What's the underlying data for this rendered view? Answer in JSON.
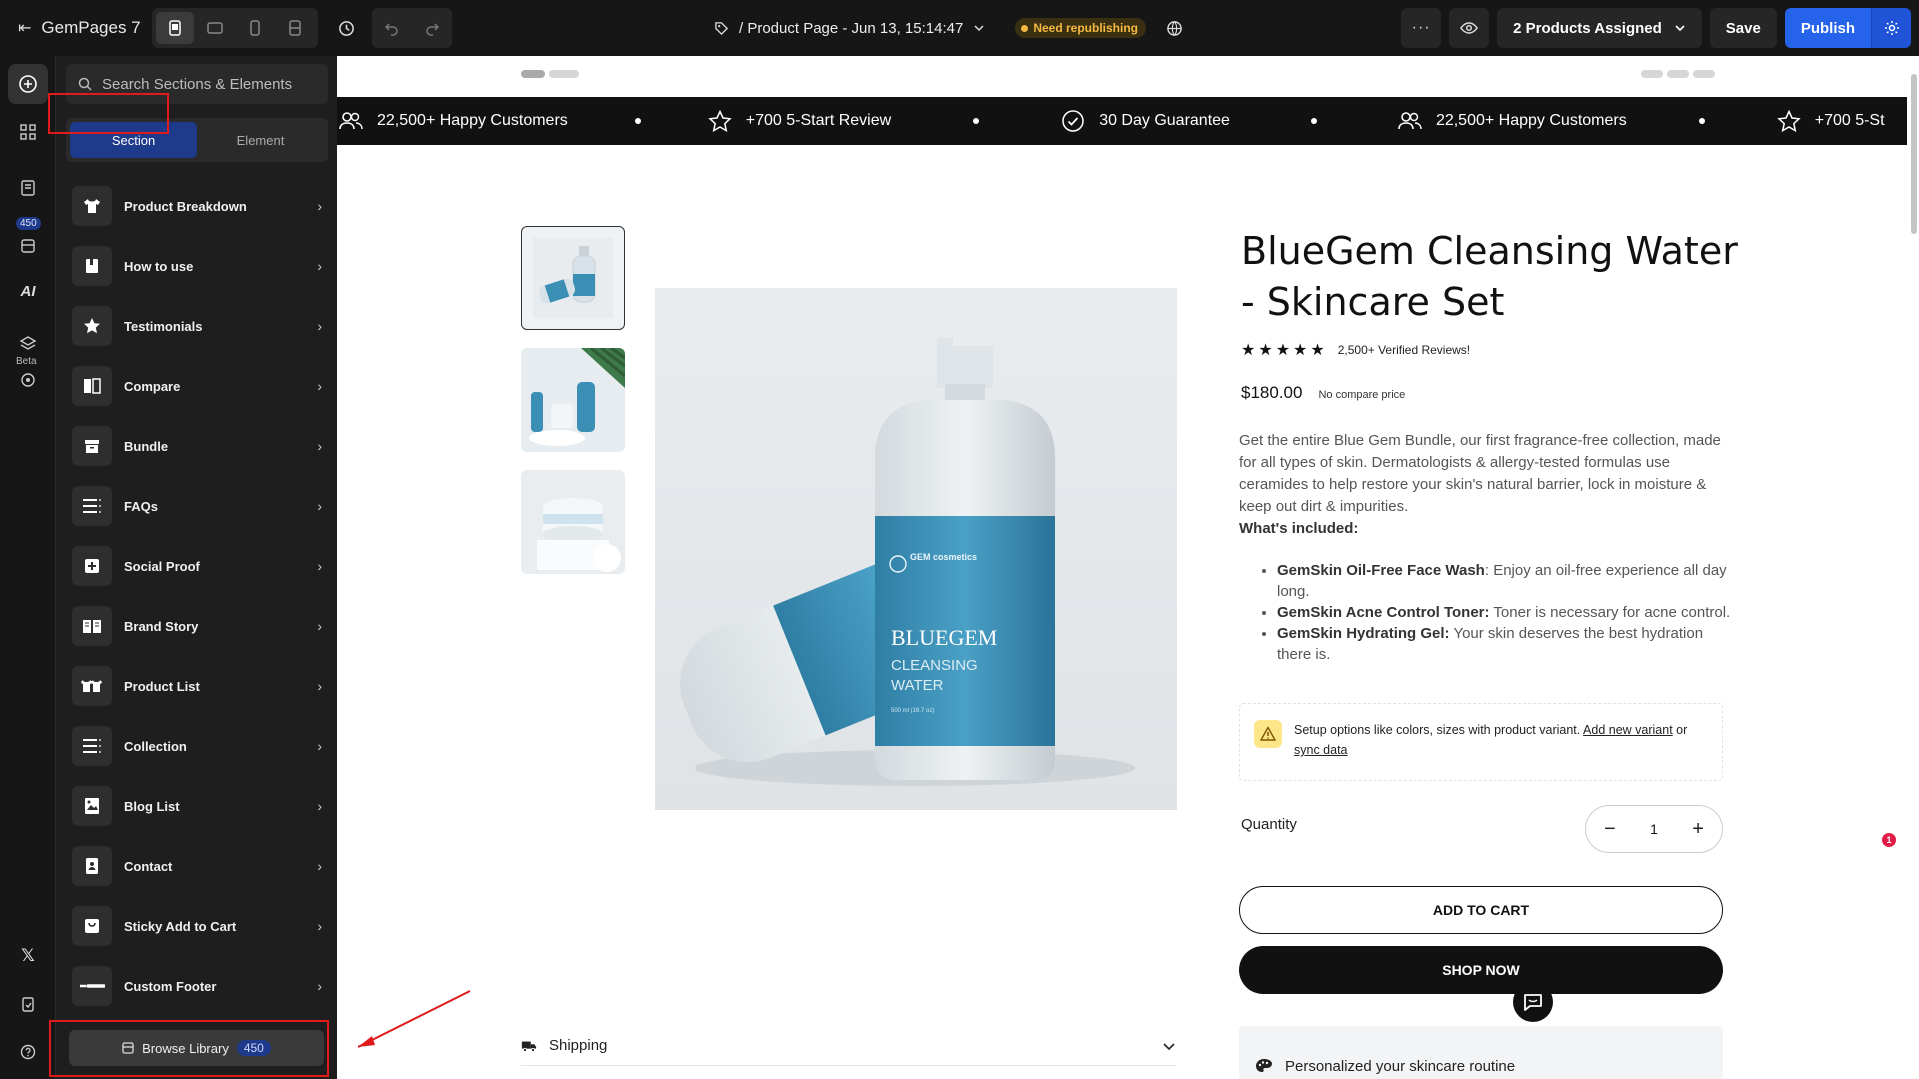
{
  "topbar": {
    "logo_text": "GemPages 7",
    "page_path": "/ Product Page - Jun 13, 15:14:47",
    "status_badge": "Need republishing",
    "products_assigned": "2 Products Assigned",
    "save_label": "Save",
    "publish_label": "Publish"
  },
  "rail": {
    "library_count": "450",
    "beta_label": "Beta",
    "ai_label": "AI"
  },
  "panel": {
    "search_placeholder": "Search Sections & Elements",
    "tabs": [
      "Section",
      "Element"
    ],
    "active_tab": "Section",
    "sections": [
      {
        "label": "Product Breakdown",
        "icon": "tshirt-icon"
      },
      {
        "label": "How to use",
        "icon": "book-icon"
      },
      {
        "label": "Testimonials",
        "icon": "star-icon"
      },
      {
        "label": "Compare",
        "icon": "compare-icon"
      },
      {
        "label": "Bundle",
        "icon": "box-icon"
      },
      {
        "label": "FAQs",
        "icon": "list-icon"
      },
      {
        "label": "Social Proof",
        "icon": "plus-square-icon"
      },
      {
        "label": "Brand Story",
        "icon": "open-book-icon"
      },
      {
        "label": "Product List",
        "icon": "tshirts-icon"
      },
      {
        "label": "Collection",
        "icon": "list-icon"
      },
      {
        "label": "Blog List",
        "icon": "image-icon"
      },
      {
        "label": "Contact",
        "icon": "contact-icon"
      },
      {
        "label": "Sticky Add to Cart",
        "icon": "cart-icon"
      },
      {
        "label": "Custom Footer",
        "icon": "footer-icon"
      }
    ],
    "browse_label": "Browse Library",
    "browse_count": "450"
  },
  "marquee": [
    {
      "text": "22,500+ Happy Customers",
      "icon": "users-icon"
    },
    {
      "text": "+700 5-Start Review",
      "icon": "star-outline-icon"
    },
    {
      "text": "30 Day Guarantee",
      "icon": "check-badge-icon"
    },
    {
      "text": "22,500+ Happy Customers",
      "icon": "users-icon"
    },
    {
      "text": "+700 5-St",
      "icon": "star-outline-icon"
    }
  ],
  "product": {
    "title": "BlueGem Cleansing Water - Skincare Set",
    "rating": 5,
    "reviews_text": "2,500+ Verified Reviews!",
    "price": "$180.00",
    "compare_price": "No compare price",
    "description": "Get the entire Blue Gem Bundle, our first fragrance-free collection, made for all types of skin. Dermatologists & allergy-tested formulas use ceramides to help restore your skin's natural barrier, lock in moisture & keep out dirt & impurities.",
    "included_heading": "What's included:",
    "included": [
      {
        "name": "GemSkin Oil-Free Face Wash",
        "text": ": Enjoy an oil-free experience all day long."
      },
      {
        "name": "GemSkin Acne Control Toner:",
        "text": " Toner is necessary for acne control."
      },
      {
        "name": "GemSkin Hydrating Gel:",
        "text": " Your skin deserves the best hydration there is."
      }
    ],
    "variant_notice": "Setup options like colors, sizes with product variant.",
    "variant_link": "Add new variant",
    "variant_or": "or",
    "sync_link": "sync data",
    "quantity_label": "Quantity",
    "quantity_value": "1",
    "add_to_cart": "ADD TO CART",
    "shop_now": "SHOP NOW",
    "shipping_label": "Shipping",
    "personalized_label": "Personalized your skincare routine",
    "bottle_brand": "GEM cosmetics",
    "bottle_name_1": "BLUEGEM",
    "bottle_name_2": "CLEANSING",
    "bottle_name_3": "WATER",
    "bottle_volume": "500 ml (16.7 oz)"
  },
  "chat": {
    "badge_count": "1"
  },
  "colors": {
    "accent": "#2563eb",
    "highlight": "#e01b1b",
    "bottle_blue": "#3b8fb5"
  }
}
